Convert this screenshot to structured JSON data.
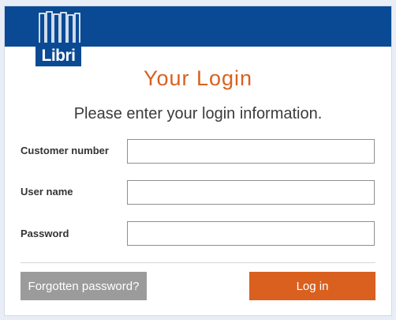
{
  "brand": {
    "logo_text": "Libri",
    "header_color": "#0a4a95",
    "accent_color": "#d9601f"
  },
  "login": {
    "title": "Your Login",
    "subtitle": "Please enter your login information.",
    "fields": [
      {
        "label": "Customer number",
        "value": ""
      },
      {
        "label": "User name",
        "value": ""
      },
      {
        "label": "Password",
        "value": ""
      }
    ]
  },
  "actions": {
    "forgot_label": "Forgotten password?",
    "login_label": "Log in"
  }
}
